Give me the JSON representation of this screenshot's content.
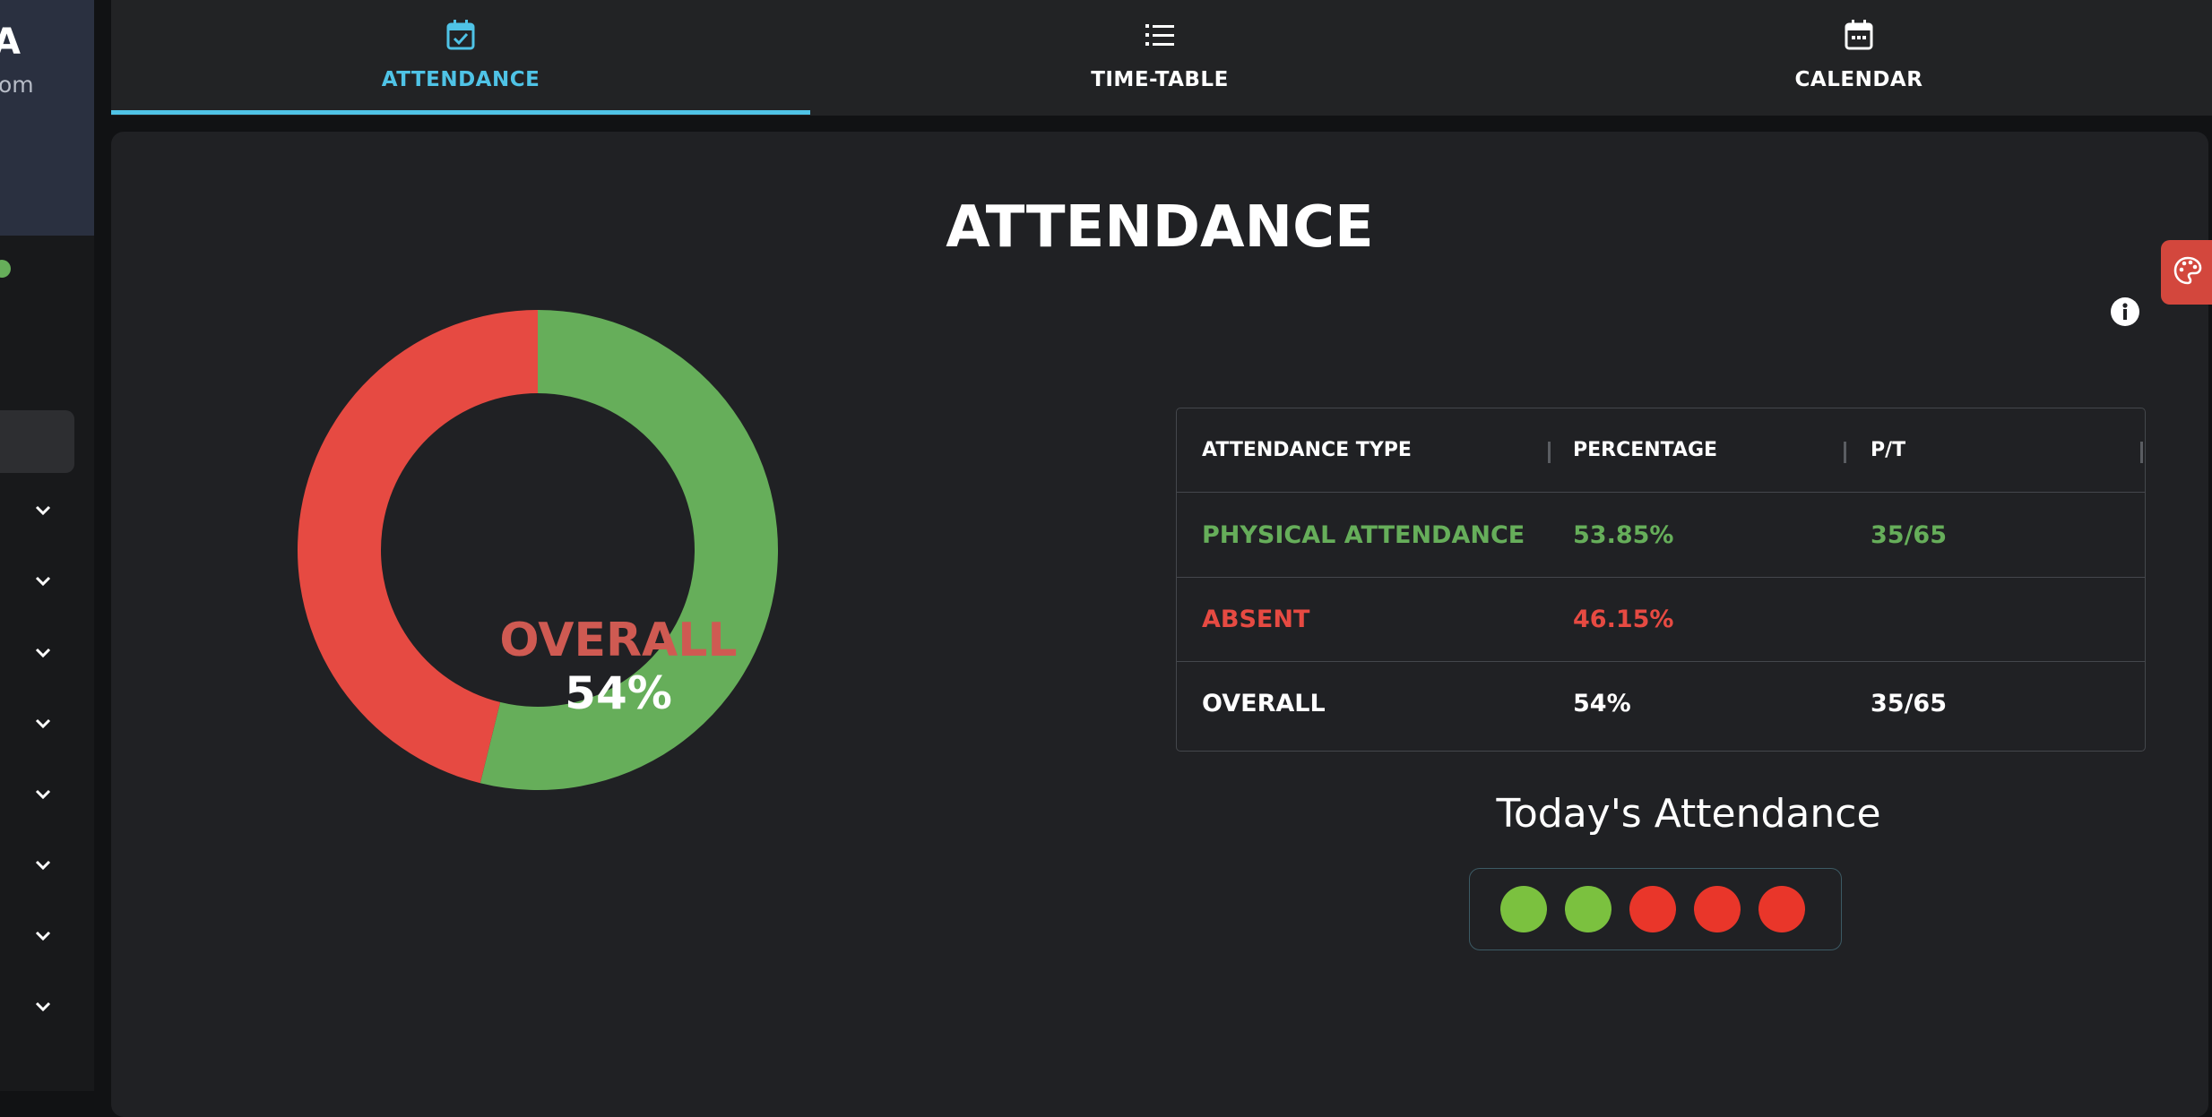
{
  "sidebar": {
    "profile_letter": "A",
    "email_fragment": "om",
    "menu_chevrons": [
      1,
      2,
      3,
      4,
      5,
      6,
      7,
      8
    ]
  },
  "tabs": [
    {
      "label": "ATTENDANCE",
      "icon": "calendar-check-icon",
      "active": true
    },
    {
      "label": "TIME-TABLE",
      "icon": "list-icon",
      "active": false
    },
    {
      "label": "CALENDAR",
      "icon": "calendar-icon",
      "active": false
    }
  ],
  "page": {
    "title": "ATTENDANCE"
  },
  "chart_data": {
    "type": "pie",
    "style": "donut",
    "categories": [
      "PHYSICAL ATTENDANCE",
      "ABSENT"
    ],
    "values": [
      53.85,
      46.15
    ],
    "colors": [
      "#66ae5a",
      "#e64a42"
    ],
    "center_label": "OVERALL",
    "center_value": "54%"
  },
  "table": {
    "headers": [
      "ATTENDANCE TYPE",
      "PERCENTAGE",
      "P/T"
    ],
    "rows": [
      {
        "type": "PHYSICAL ATTENDANCE",
        "percentage": "53.85%",
        "pt": "35/65",
        "color": "#66ae5a"
      },
      {
        "type": "ABSENT",
        "percentage": "46.15%",
        "pt": "",
        "color": "#e64a42"
      },
      {
        "type": "OVERALL",
        "percentage": "54%",
        "pt": "35/65",
        "color": "#ffffff"
      }
    ]
  },
  "today": {
    "title": "Today's Attendance",
    "statuses": [
      "present",
      "present",
      "absent",
      "absent",
      "absent"
    ],
    "colors": {
      "present": "#7bc13f",
      "absent": "#e9362a"
    }
  },
  "colors": {
    "accent": "#4fc3e6",
    "present": "#66ae5a",
    "absent": "#e64a42"
  }
}
